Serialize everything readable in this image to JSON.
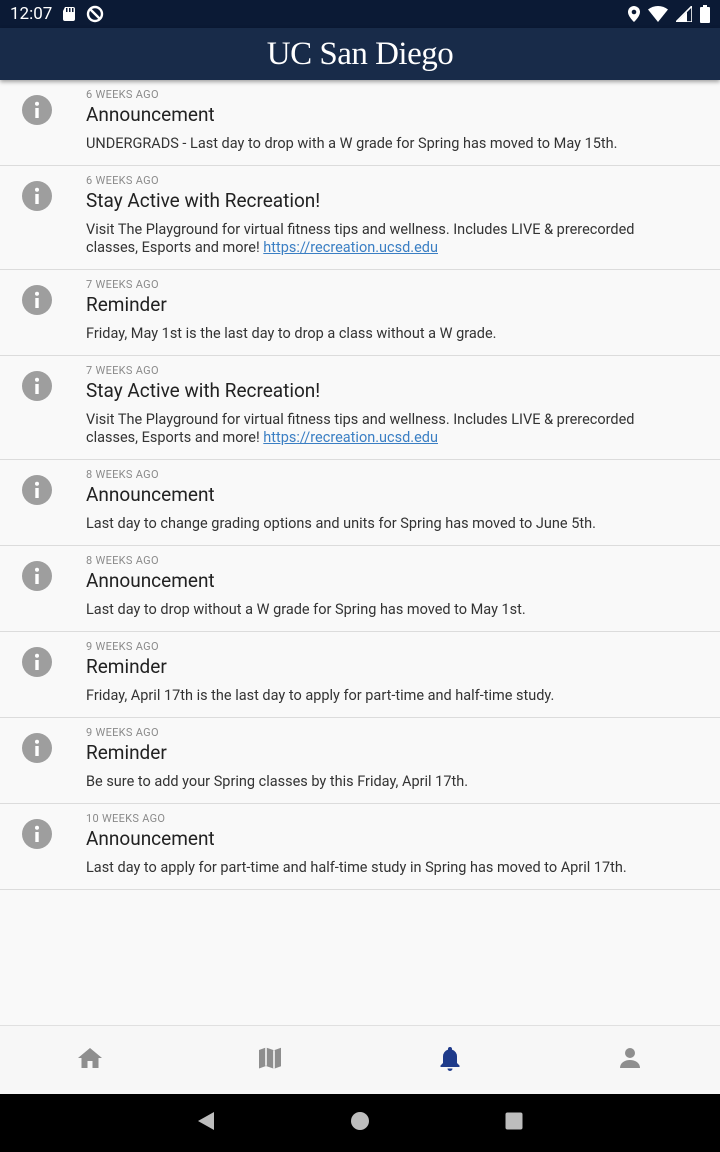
{
  "status_bar": {
    "time": "12:07"
  },
  "app_bar": {
    "title": "UC San Diego"
  },
  "notifications": [
    {
      "ago": "6 WEEKS AGO",
      "title": "Announcement",
      "body": "UNDERGRADS - Last day to drop with a W grade for Spring has moved to May 15th.",
      "link": ""
    },
    {
      "ago": "6 WEEKS AGO",
      "title": "Stay Active with Recreation!",
      "body": "Visit The Playground for virtual fitness tips and wellness. Includes LIVE & prerecorded classes, Esports and more! ",
      "link": "https://recreation.ucsd.edu"
    },
    {
      "ago": "7 WEEKS AGO",
      "title": "Reminder",
      "body": "Friday, May 1st is the last day to drop a class without a W grade.",
      "link": ""
    },
    {
      "ago": "7 WEEKS AGO",
      "title": "Stay Active with Recreation!",
      "body": "Visit The Playground for virtual fitness tips and wellness. Includes LIVE & prerecorded classes, Esports and more! ",
      "link": "https://recreation.ucsd.edu"
    },
    {
      "ago": "8 WEEKS AGO",
      "title": "Announcement",
      "body": "Last day to change grading options and units for Spring has moved to June 5th.",
      "link": ""
    },
    {
      "ago": "8 WEEKS AGO",
      "title": "Announcement",
      "body": "Last day to drop without a W grade for Spring has moved to May 1st.",
      "link": ""
    },
    {
      "ago": "9 WEEKS AGO",
      "title": "Reminder",
      "body": "Friday, April 17th is the last day to apply for part-time and half-time study.",
      "link": ""
    },
    {
      "ago": "9 WEEKS AGO",
      "title": "Reminder",
      "body": "Be sure to add your Spring classes by this Friday, April 17th.",
      "link": ""
    },
    {
      "ago": "10 WEEKS AGO",
      "title": "Announcement",
      "body": "Last day to apply for part-time and half-time study in Spring has moved to April 17th.",
      "link": ""
    }
  ],
  "bottom_nav": {
    "tabs": [
      {
        "icon": "home-icon",
        "active": false
      },
      {
        "icon": "map-icon",
        "active": false
      },
      {
        "icon": "bell-icon",
        "active": true
      },
      {
        "icon": "person-icon",
        "active": false
      }
    ],
    "active_color": "#1e3a8a",
    "inactive_color": "#8e8e8e"
  },
  "colors": {
    "status_bar": "#0b1a35",
    "app_bar": "#182b49",
    "info_icon": "#9e9e9e",
    "link": "#3b7fc4"
  }
}
